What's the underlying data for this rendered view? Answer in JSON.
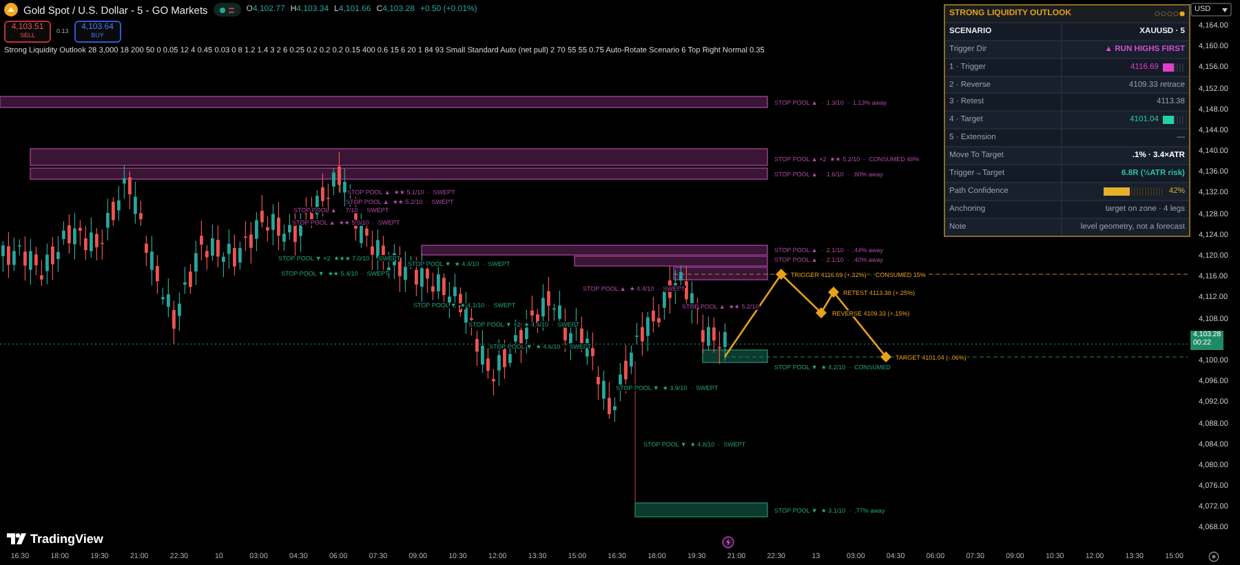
{
  "header": {
    "symbol": "Gold Spot / U.S. Dollar - 5 - GO Markets",
    "ohlc": [
      {
        "label": "O",
        "value": "4,102.77"
      },
      {
        "label": "H",
        "value": "4,103.34"
      },
      {
        "label": "L",
        "value": "4,101.66"
      },
      {
        "label": "C",
        "value": "4,103.28"
      }
    ],
    "change": "+0.50 (+0.01%)",
    "indicator_visible": true,
    "sell": {
      "price": "4,103.51",
      "label": "SELL"
    },
    "spread": "0.13",
    "buy": {
      "price": "4,103.64",
      "label": "BUY"
    },
    "indicator": "Strong Liquidity Outlook 28 3,000 18 200 50 0 0.05 12 4 0.45 0.03 0 8 1.2 1.4 3 2 6 0.25 0.2 0.2 0.2 0.15 400 0.6 15 6 20 1 84 93 Small Standard Auto (net pull) 2 70 55 55 0.75 Auto-Rotate Scenario 6 Top Right Normal 0.35"
  },
  "panel": {
    "title": "STRONG LIQUIDITY OUTLOOK",
    "rows": [
      {
        "kind": "header",
        "label": "SCENARIO",
        "value": "XAUUSD · 5"
      },
      {
        "kind": "colored",
        "label": "Trigger Dir",
        "value": "▲ RUN HIGHS FIRST",
        "color": "#d050d8"
      },
      {
        "kind": "swatch",
        "label": "1 · Trigger",
        "value": "4116.69",
        "color": "#e040c8"
      },
      {
        "kind": "text",
        "label": "2 · Reverse",
        "value": "4109.33  retrace"
      },
      {
        "kind": "text",
        "label": "3 · Retest",
        "value": "4113.38"
      },
      {
        "kind": "swatch",
        "label": "4 · Target",
        "value": "4101.04",
        "color": "#22d3a0"
      },
      {
        "kind": "text",
        "label": "5 · Extension",
        "value": "—"
      },
      {
        "kind": "strong",
        "label": "Move To Target",
        "value": ".1%  ·  3.4×ATR"
      },
      {
        "kind": "colored",
        "label": "Trigger→Target",
        "value": "6.8R  (½ATR risk)",
        "color": "#26c6a0"
      },
      {
        "kind": "meter",
        "label": "Path Confidence",
        "value": "42%",
        "level": 0.42
      },
      {
        "kind": "text",
        "label": "Anchoring",
        "value": "target on zone · 4 legs"
      },
      {
        "kind": "text",
        "label": "Note",
        "value": "level geometry, not a forecast"
      }
    ]
  },
  "chart_labels": [
    {
      "kind": "above",
      "text": "STOP POOL ▲  ·  1.3/10  ·  1.13% away"
    },
    {
      "kind": "above",
      "text": "STOP POOL ▲ ×2  ★★ 5.2/10  ·  CONSUMED 48%"
    },
    {
      "kind": "above",
      "text": "STOP POOL ▲  ·  1.6/10  ·  .80% away"
    },
    {
      "kind": "above",
      "text": "STOP POOL ▲  ★★ 5.1/10  ·  SWEPT"
    },
    {
      "kind": "above",
      "text": "STOP POOL ▲  ★★ 5.2/10  ·  SWEPT"
    },
    {
      "kind": "above",
      "text": "STOP POOL ▲  ·  7/10  ·  SWEPT"
    },
    {
      "kind": "above",
      "text": "STOP POOL ▲  ★★ 5.0/10  ·  SWEPT"
    },
    {
      "kind": "above",
      "text": "STOP POOL ▲  ·  2.1/10  ·  .44% away"
    },
    {
      "kind": "below",
      "text": "STOP POOL ▼ ×2  ★★★ 7.0/10  ·  SWEPT"
    },
    {
      "kind": "below",
      "text": "STOP POOL ▼  ★ 4.4/10  ·  SWEPT"
    },
    {
      "kind": "above",
      "text": "STOP POOL ▲  ·  2.1/10  ·  .40% away"
    },
    {
      "kind": "below",
      "text": "STOP POOL ▼  ★★ 5.4/10  ·  SWEPT"
    },
    {
      "kind": "plan",
      "text": "TRIGGER 4116.69 (+.32%)  ·  CONSUMED 15%"
    },
    {
      "kind": "above",
      "text": "STOP POOL ▲  ★ 4.4/10  ·  SWEPT"
    },
    {
      "kind": "plan",
      "text": "RETEST 4113.38 (+.25%)"
    },
    {
      "kind": "below",
      "text": "STOP POOL ▼  ★ 4.1/10  ·  SWEPT"
    },
    {
      "kind": "above",
      "text": "STOP POOL ▲  ★★ 5.2/10"
    },
    {
      "kind": "plan",
      "text": "REVERSE 4109.33 (+.15%)"
    },
    {
      "kind": "below",
      "text": "STOP POOL ▼ ×2  ★ 4.4/10  ·  SWEPT"
    },
    {
      "kind": "below",
      "text": "STOP POOL ▼  ★ 4.6/10  ·  SWEPT"
    },
    {
      "kind": "below",
      "text": "STOP POOL ▼  ★ 4.2/10  ·  CONSUMED"
    },
    {
      "kind": "plan",
      "text": "TARGET 4101.04 (-.06%)"
    },
    {
      "kind": "below",
      "text": "STOP POOL ▼  ★ 3.9/10  ·  SWEPT"
    },
    {
      "kind": "below",
      "text": "STOP POOL ▼  ★ 4.8/10  ·  SWEPT"
    },
    {
      "kind": "below",
      "text": "STOP POOL ▼  ★ 3.1/10  ·  .77% away"
    }
  ],
  "brand": "TradingView",
  "price_scale": {
    "currency": "USD",
    "ticks": [
      {
        "kind": "tick",
        "label": "4,164.00"
      },
      {
        "kind": "tick",
        "label": "4,160.00"
      },
      {
        "kind": "tick",
        "label": "4,156.00"
      },
      {
        "kind": "tick",
        "label": "4,152.00"
      },
      {
        "kind": "tick",
        "label": "4,148.00"
      },
      {
        "kind": "tick",
        "label": "4,144.00"
      },
      {
        "kind": "tick",
        "label": "4,140.00"
      },
      {
        "kind": "tick",
        "label": "4,136.00"
      },
      {
        "kind": "tick",
        "label": "4,132.00"
      },
      {
        "kind": "tick",
        "label": "4,128.00"
      },
      {
        "kind": "tick",
        "label": "4,124.00"
      },
      {
        "kind": "tick",
        "label": "4,120.00"
      },
      {
        "kind": "tick",
        "label": "4,116.00"
      },
      {
        "kind": "tick",
        "label": "4,112.00"
      },
      {
        "kind": "tick",
        "label": "4,108.00"
      },
      {
        "kind": "current",
        "label": "4,103.28",
        "countdown": "00:22"
      },
      {
        "kind": "tick",
        "label": "4,100.00"
      },
      {
        "kind": "tick",
        "label": "4,096.00"
      },
      {
        "kind": "tick",
        "label": "4,092.00"
      },
      {
        "kind": "tick",
        "label": "4,088.00"
      },
      {
        "kind": "tick",
        "label": "4,084.00"
      },
      {
        "kind": "tick",
        "label": "4,080.00"
      },
      {
        "kind": "tick",
        "label": "4,076.00"
      },
      {
        "kind": "tick",
        "label": "4,072.00"
      },
      {
        "kind": "tick",
        "label": "4,068.00"
      }
    ]
  },
  "time_axis": [
    "16:30",
    "18:00",
    "19:30",
    "21:00",
    "22:30",
    "10",
    "03:00",
    "04:30",
    "06:00",
    "07:30",
    "09:00",
    "10:30",
    "12:00",
    "13:30",
    "15:00",
    "16:30",
    "18:00",
    "19:30",
    "21:00",
    "22:30",
    "13",
    "03:00",
    "04:30",
    "06:00",
    "07:30",
    "09:00",
    "10:30",
    "12:00",
    "13:30",
    "15:00"
  ]
}
